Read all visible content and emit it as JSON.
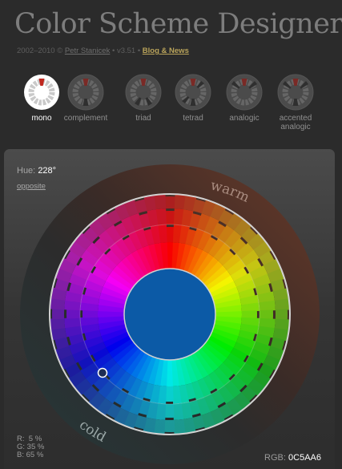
{
  "header": {
    "title": "Color Scheme Designer",
    "years": "2002–2010 ©",
    "author": "Petr Stanicek",
    "version": "• v3.51 •",
    "blog_link": "Blog & News"
  },
  "modes": [
    {
      "label": "mono",
      "active": true
    },
    {
      "label": "complement",
      "active": false
    },
    {
      "label": "triad",
      "active": false
    },
    {
      "label": "tetrad",
      "active": false
    },
    {
      "label": "analogic",
      "active": false
    },
    {
      "label": "accented analogic",
      "active": false
    }
  ],
  "hue": {
    "label": "Hue:",
    "value": "228°",
    "opposite_link": "opposite"
  },
  "wheel": {
    "warm_label": "warm",
    "cold_label": "cold",
    "selected_color": "#0C5AA6"
  },
  "rgb": {
    "r_label": "R:",
    "r_value": "5 %",
    "g_label": "G:",
    "g_value": "35 %",
    "b_label": "B:",
    "b_value": "65 %",
    "hex_label": "RGB:",
    "hex_value": "0C5AA6"
  },
  "colors": {
    "accent_red": "#c0281f",
    "link_gold": "#b9a35a",
    "background": "#2b2b2b"
  }
}
